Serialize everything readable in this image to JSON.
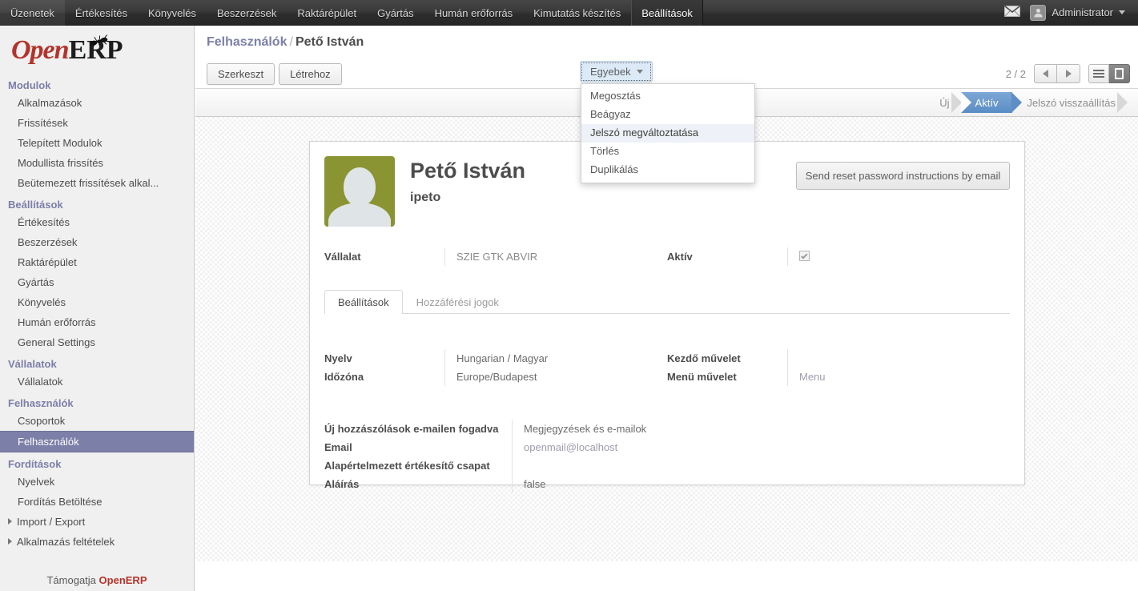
{
  "topbar": {
    "menu": [
      {
        "label": "Üzenetek",
        "active": false
      },
      {
        "label": "Értékesítés",
        "active": false
      },
      {
        "label": "Könyvelés",
        "active": false
      },
      {
        "label": "Beszerzések",
        "active": false
      },
      {
        "label": "Raktárépület",
        "active": false
      },
      {
        "label": "Gyártás",
        "active": false
      },
      {
        "label": "Humán erőforrás",
        "active": false
      },
      {
        "label": "Kimutatás készítés",
        "active": false
      },
      {
        "label": "Beállítások",
        "active": true
      }
    ],
    "mail_icon": "envelope-icon",
    "user_name": "Administrator",
    "user_caret": "chevron-down-icon"
  },
  "sidebar": {
    "logo": {
      "open": "Open",
      "erp": "ERP",
      "ant": "ant-icon"
    },
    "sections": [
      {
        "title": "Modulok",
        "items": [
          {
            "label": "Alkalmazások",
            "selected": false,
            "folder": false
          },
          {
            "label": "Frissítések",
            "selected": false,
            "folder": false
          },
          {
            "label": "Telepített Modulok",
            "selected": false,
            "folder": false
          },
          {
            "label": "Modullista frissítés",
            "selected": false,
            "folder": false
          },
          {
            "label": "Beütemezett frissítések alkal...",
            "selected": false,
            "folder": false
          }
        ]
      },
      {
        "title": "Beállítások",
        "items": [
          {
            "label": "Értékesítés",
            "selected": false,
            "folder": false
          },
          {
            "label": "Beszerzések",
            "selected": false,
            "folder": false
          },
          {
            "label": "Raktárépület",
            "selected": false,
            "folder": false
          },
          {
            "label": "Gyártás",
            "selected": false,
            "folder": false
          },
          {
            "label": "Könyvelés",
            "selected": false,
            "folder": false
          },
          {
            "label": "Humán erőforrás",
            "selected": false,
            "folder": false
          },
          {
            "label": "General Settings",
            "selected": false,
            "folder": false
          }
        ]
      },
      {
        "title": "Vállalatok",
        "items": [
          {
            "label": "Vállalatok",
            "selected": false,
            "folder": false
          }
        ]
      },
      {
        "title": "Felhasználók",
        "items": [
          {
            "label": "Csoportok",
            "selected": false,
            "folder": false
          },
          {
            "label": "Felhasználók",
            "selected": true,
            "folder": false
          }
        ]
      },
      {
        "title": "Fordítások",
        "items": [
          {
            "label": "Nyelvek",
            "selected": false,
            "folder": false
          },
          {
            "label": "Fordítás Betöltése",
            "selected": false,
            "folder": false
          },
          {
            "label": "Import / Export",
            "selected": false,
            "folder": true
          },
          {
            "label": "Alkalmazás feltételek",
            "selected": false,
            "folder": true
          }
        ]
      }
    ],
    "footer": {
      "prefix": "Támogatja ",
      "brand": "OpenERP"
    }
  },
  "breadcrumb": {
    "root": "Felhasználók",
    "separator": "/",
    "current": "Pető István"
  },
  "control_panel": {
    "edit_label": "Szerkeszt",
    "create_label": "Létrehoz",
    "more_label": "Egyebek",
    "more_caret": "chevron-down-icon",
    "dropdown_items": [
      {
        "label": "Megosztás",
        "highlighted": false
      },
      {
        "label": "Beágyaz",
        "highlighted": false
      },
      {
        "label": "Jelszó megváltoztatása",
        "highlighted": true
      },
      {
        "label": "Törlés",
        "highlighted": false
      },
      {
        "label": "Duplikálás",
        "highlighted": false
      }
    ],
    "pager": "2 / 2",
    "prev_icon": "arrow-left-icon",
    "next_icon": "arrow-right-icon",
    "view_list_icon": "list-view-icon",
    "view_form_icon": "form-view-icon"
  },
  "statusbar": {
    "items": [
      {
        "label": "Új",
        "state": "plain"
      },
      {
        "label": "Aktív",
        "state": "done"
      },
      {
        "label": "Jelszó visszaállítás",
        "state": "plain"
      }
    ]
  },
  "form": {
    "avatar": "user-avatar",
    "user_name": "Pető István",
    "login": "ipeto",
    "reset_button": "Send reset password instructions by email",
    "top_fields": {
      "company_label": "Vállalat",
      "company_value": "SZIE GTK ABVIR",
      "active_label": "Aktív",
      "active_checked": true
    },
    "tabs": [
      {
        "label": "Beállítások",
        "active": true
      },
      {
        "label": "Hozzáférési jogok",
        "active": false
      }
    ],
    "prefs": {
      "left": [
        {
          "label": "Nyelv",
          "value": "Hungarian / Magyar"
        },
        {
          "label": "Időzóna",
          "value": "Europe/Budapest"
        }
      ],
      "right": [
        {
          "label": "Kezdő művelet",
          "value": ""
        },
        {
          "label": "Menü művelet",
          "value": "Menu"
        }
      ],
      "lower_left": [
        {
          "label": "Új hozzászólások e-mailen fogadva",
          "value": "Megjegyzések és e-mailok"
        },
        {
          "label": "Email",
          "value": "openmail@localhost"
        },
        {
          "label": "Alapértelmezett értékesítő csapat",
          "value": ""
        },
        {
          "label": "Aláírás",
          "value": "false"
        }
      ]
    }
  },
  "colors": {
    "accent": "#7c7fa8",
    "brand_red": "#b3332b",
    "status_blue": "#5a8cc4",
    "avatar_green": "#8a9432"
  }
}
